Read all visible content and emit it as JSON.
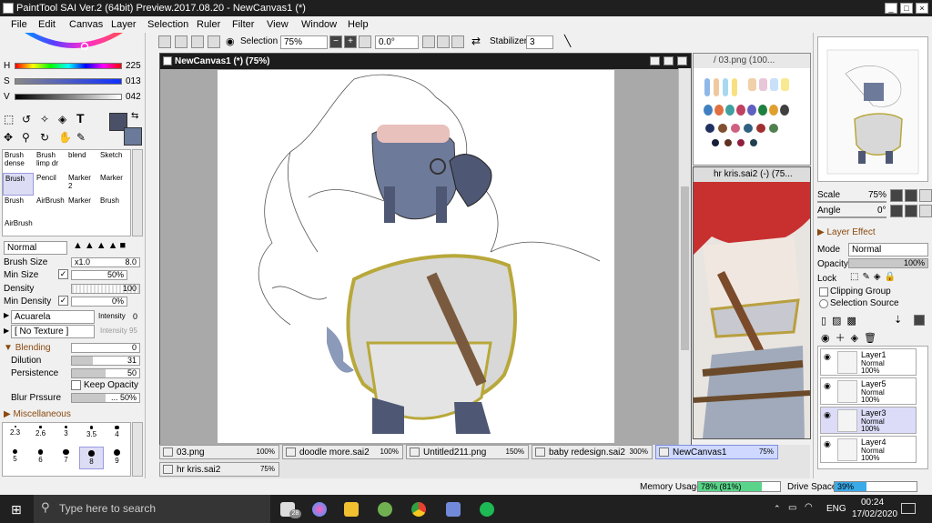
{
  "window": {
    "title": "PaintTool SAI Ver.2 (64bit) Preview.2017.08.20 - NewCanvas1 (*)"
  },
  "menu": [
    "File",
    "Edit",
    "Canvas",
    "Layer",
    "Selection",
    "Ruler",
    "Filter",
    "View",
    "Window",
    "Help"
  ],
  "toolbar": {
    "selection_label": "Selection",
    "zoom": "75%",
    "rotation": "0.0°",
    "stabilizer_label": "Stabilizer",
    "stabilizer_value": "3"
  },
  "color": {
    "h_label": "H",
    "h_value": "225",
    "s_label": "S",
    "s_value": "013",
    "v_label": "V",
    "v_value": "042",
    "main": "#4a5068",
    "secondary": "#6a7a9a"
  },
  "brushes": [
    [
      "Brush dense",
      "Brush limp dr",
      "blend",
      "Sketch"
    ],
    [
      "Brush",
      "Pencil",
      "Marker 2",
      "Marker"
    ],
    [
      "Brush",
      "AirBrush",
      "Marker",
      "Brush"
    ],
    [
      "AirBrush",
      "",
      "",
      ""
    ]
  ],
  "brush_props": {
    "size_label": "Brush Size",
    "size_mult": "x1.0",
    "size_value": "8.0",
    "minsize_label": "Min Size",
    "minsize_value": "50%",
    "density_label": "Density",
    "density_value": "100",
    "mindensity_label": "Min Density",
    "mindensity_value": "0%",
    "paper": "Acuarela",
    "intensity_label": "Intensity",
    "intensity_value": "0",
    "texture": "[ No Texture ]",
    "intensity2": "Intensity 95",
    "blending_label": "Blending",
    "blending_value": "0",
    "dilution_label": "Dilution",
    "dilution_value": "31",
    "persistence_label": "Persistence",
    "persistence_value": "50",
    "keep_opacity": "Keep Opacity",
    "blur_label": "Blur Prssure",
    "blur_value": "... 50%",
    "misc_label": "Miscellaneous"
  },
  "dots": [
    "2.3",
    "2.6",
    "3",
    "3.5",
    "4",
    "5",
    "6",
    "7",
    "8",
    "9"
  ],
  "canvas": {
    "title": "NewCanvas1 (*) (75%)"
  },
  "side_windows": {
    "win2": "/ 03.png (100...",
    "win3": "hr kris.sai2 (-) (75..."
  },
  "tabs": [
    {
      "name": "03.png",
      "pct": "100%"
    },
    {
      "name": "doodle more.sai2",
      "pct": "100%"
    },
    {
      "name": "Untitled211.png",
      "pct": "150%"
    },
    {
      "name": "baby redesign.sai2",
      "pct": "300%"
    },
    {
      "name": "NewCanvas1",
      "pct": "75%"
    },
    {
      "name": "hr kris.sai2",
      "pct": "75%"
    }
  ],
  "nav": {
    "scale_label": "Scale",
    "scale_value": "75%",
    "angle_label": "Angle",
    "angle_value": "0°"
  },
  "layer_effect": {
    "title": "Layer Effect",
    "mode_label": "Mode",
    "mode_value": "Normal",
    "opacity_label": "Opacity",
    "opacity_value": "100%",
    "lock_label": "Lock",
    "clipping": "Clipping Group",
    "selsource": "Selection Source"
  },
  "layers": [
    {
      "name": "Layer1",
      "mode": "Normal",
      "opacity": "100%"
    },
    {
      "name": "Layer5",
      "mode": "Normal",
      "opacity": "100%"
    },
    {
      "name": "Layer3",
      "mode": "Normal",
      "opacity": "100%"
    },
    {
      "name": "Layer4",
      "mode": "Normal",
      "opacity": "100%"
    }
  ],
  "status": {
    "memory_label": "Memory Usage",
    "memory_value": "78% (81%)",
    "memory_fill": 0.78,
    "drive_label": "Drive Space",
    "drive_value": "39%",
    "drive_fill": 0.39
  },
  "taskbar": {
    "search": "Type here to search",
    "badge": "28",
    "lang": "ENG",
    "time": "00:24",
    "date": "17/02/2020"
  }
}
